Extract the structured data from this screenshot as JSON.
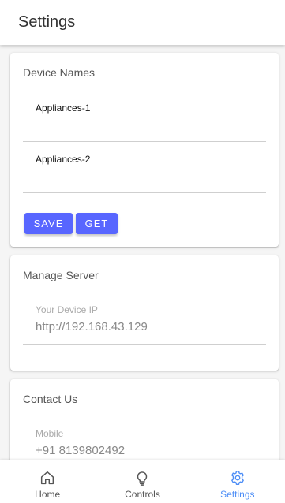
{
  "app_bar": {
    "title": "Settings"
  },
  "device_names": {
    "title": "Device Names",
    "fields": [
      {
        "value": "Appliances-1"
      },
      {
        "value": "Appliances-2"
      }
    ],
    "save_label": "SAVE",
    "get_label": "GET"
  },
  "manage_server": {
    "title": "Manage Server",
    "ip_label": "Your Device IP",
    "ip_value": "http://192.168.43.129"
  },
  "contact": {
    "title": "Contact Us",
    "mobile_label": "Mobile",
    "mobile_value": "+91 8139802492"
  },
  "bottom_nav": {
    "items": [
      {
        "label": "Home",
        "icon": "home-icon",
        "active": false
      },
      {
        "label": "Controls",
        "icon": "lightbulb-icon",
        "active": false
      },
      {
        "label": "Settings",
        "icon": "gear-icon",
        "active": true
      }
    ]
  },
  "colors": {
    "accent": "#5866ff",
    "nav_active": "#4c8df6"
  }
}
